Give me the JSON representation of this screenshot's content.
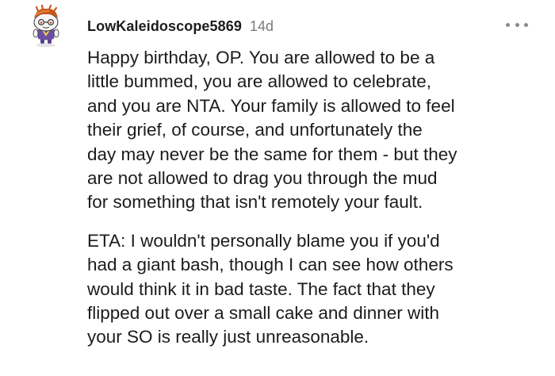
{
  "comment": {
    "avatar_icon": "snoo-avatar-icon",
    "username": "LowKaleidoscope5869",
    "age": "14d",
    "menu_icon": "more-options-icon",
    "paragraphs": [
      "Happy birthday, OP. You are allowed to be a\nlittle bummed, you are allowed to celebrate,\nand you are NTA. Your family is allowed to feel\ntheir grief, of course, and unfortunately the\nday may never be the same for them - but they\nare not allowed to drag you through the mud\nfor something that isn't remotely your fault.",
      "ETA: I wouldn't personally blame you if you'd\nhad a giant bash, though I can see how others\nwould think it in bad taste. The fact that they\nflipped out over a small cake and dinner with\nyour SO is really just unreasonable."
    ]
  },
  "colors": {
    "text": "#1c1c1c",
    "muted": "#7c7c7c",
    "icon": "#878a8c"
  }
}
